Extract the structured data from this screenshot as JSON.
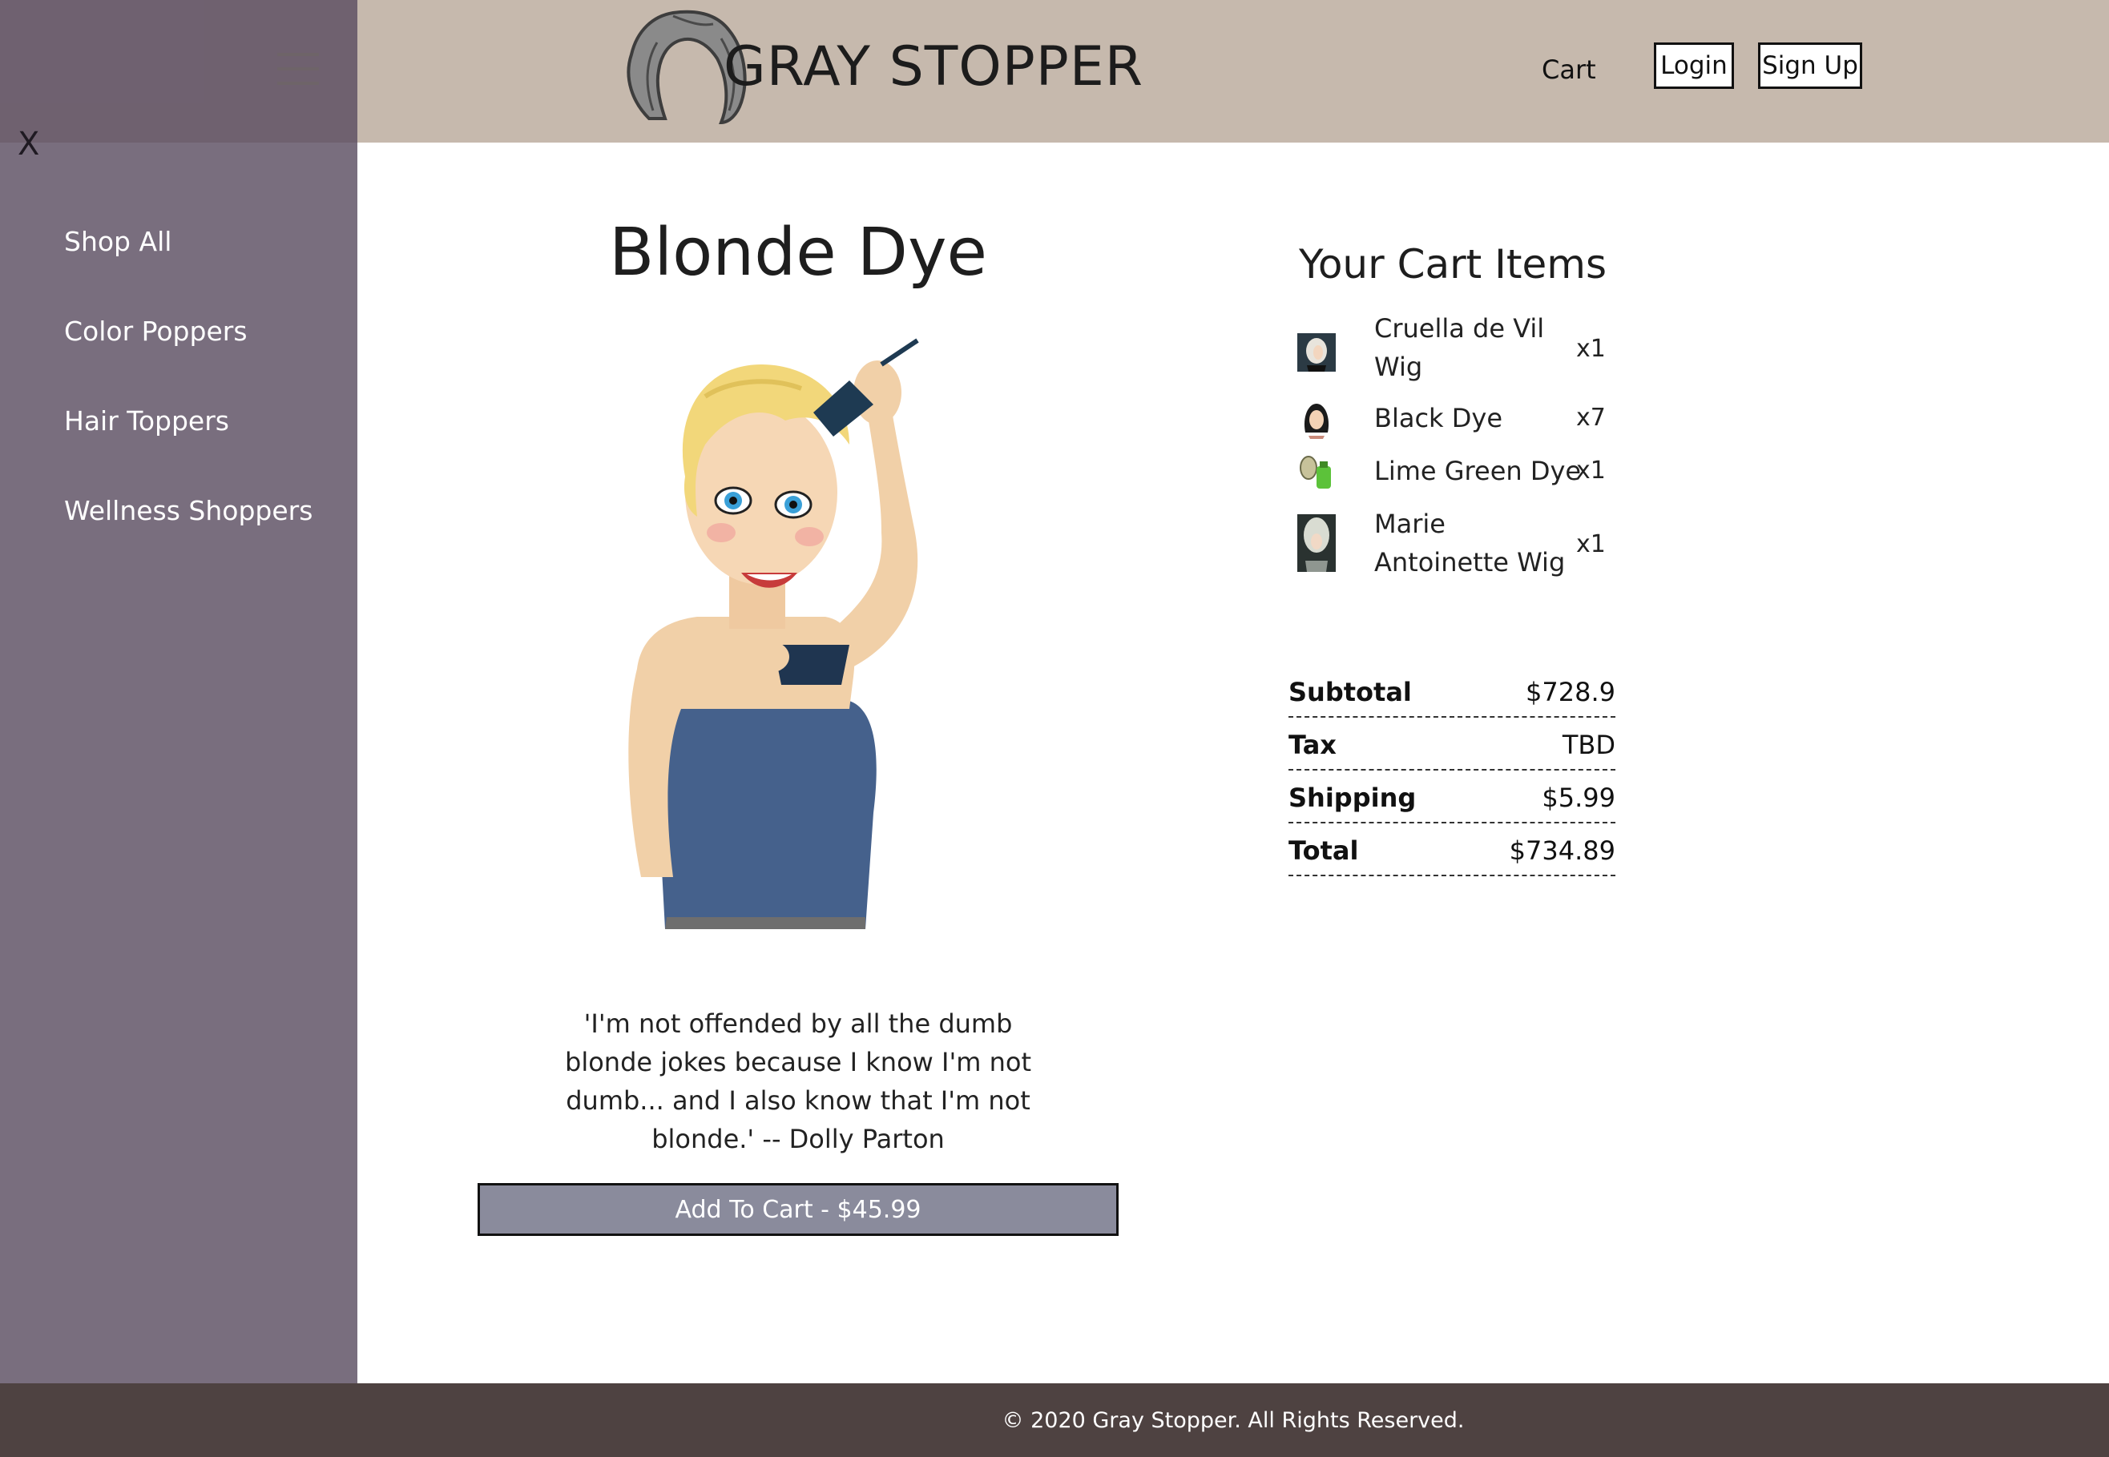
{
  "header": {
    "brand": "GRAY STOPPER",
    "cart_label": "Cart",
    "login_label": "Login",
    "signup_label": "Sign Up",
    "icons": {
      "menu": "hamburger-icon",
      "logo": "gray-hair-logo"
    },
    "background_color": "#c6b9ad"
  },
  "sidebar": {
    "close_label": "X",
    "items": [
      {
        "label": "Shop All"
      },
      {
        "label": "Color Poppers"
      },
      {
        "label": "Hair Toppers"
      },
      {
        "label": "Wellness Shoppers"
      }
    ]
  },
  "product": {
    "title": "Blonde Dye",
    "image_icon": "blonde-woman-dyeing-hair-illustration",
    "quote": "'I'm not offended by all the dumb blonde jokes because I know I'm not dumb... and I also know that I'm not blonde.' -- Dolly Parton",
    "add_to_cart_label": "Add To Cart - $45.99"
  },
  "cart": {
    "title": "Your Cart Items",
    "items": [
      {
        "name": "Cruella de Vil Wig",
        "qty": "x1",
        "thumb_icon": "cruella-wig-thumbnail"
      },
      {
        "name": "Black Dye",
        "qty": "x7",
        "thumb_icon": "black-dye-thumbnail"
      },
      {
        "name": "Lime Green Dye",
        "qty": "x1",
        "thumb_icon": "lime-green-dye-thumbnail"
      },
      {
        "name": "Marie Antoinette Wig",
        "qty": "x1",
        "thumb_icon": "marie-antoinette-wig-thumbnail"
      }
    ],
    "summary": [
      {
        "label": "Subtotal",
        "value": "$728.9"
      },
      {
        "label": "Tax",
        "value": "TBD"
      },
      {
        "label": "Shipping",
        "value": "$5.99"
      },
      {
        "label": "Total",
        "value": "$734.89"
      }
    ]
  },
  "footer": {
    "text": "© 2020 Gray Stopper. All Rights Reserved."
  }
}
